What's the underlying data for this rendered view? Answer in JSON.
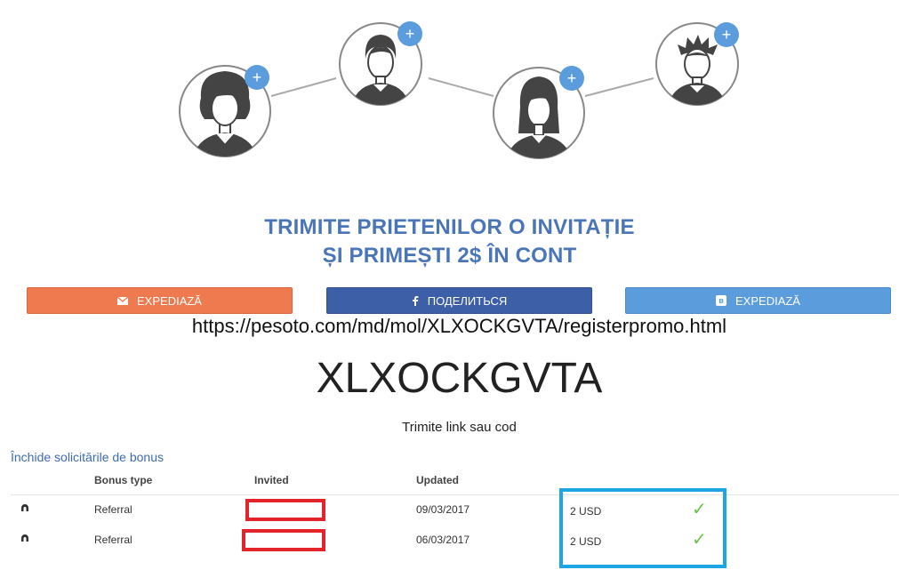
{
  "headline": {
    "line1": "TRIMITE PRIETENILOR O INVITAȚIE",
    "line2": "ȘI PRIMEȘTI 2$ ÎN CONT"
  },
  "share_buttons": [
    {
      "label": "EXPEDIAZĂ",
      "icon": "envelope-icon",
      "color": "#ef7a4f"
    },
    {
      "label": "ПОДЕЛИТЬСЯ",
      "icon": "facebook-icon",
      "color": "#3d5fa8"
    },
    {
      "label": "EXPEDIAZĂ",
      "icon": "vk-icon",
      "color": "#5b9ddc"
    }
  ],
  "referral_link": "https://pesoto.com/md/mol/XLXOCKGVTA/registerpromo.html",
  "promo_code": "XLXOCKGVTA",
  "hint": "Trimite link sau cod",
  "close_requests_link": "Închide solicitările de bonus",
  "table": {
    "headers": {
      "bonus_type": "Bonus type",
      "invited": "Invited",
      "updated": "Updated"
    },
    "rows": [
      {
        "icon": "magnet-icon",
        "bonus_type": "Referral",
        "invited": "",
        "updated": "09/03/2017",
        "amount": "2 USD",
        "status": "✓"
      },
      {
        "icon": "magnet-icon",
        "bonus_type": "Referral",
        "invited": "",
        "updated": "06/03/2017",
        "amount": "2 USD",
        "status": "✓"
      }
    ]
  },
  "colors": {
    "headline": "#4a76b8",
    "plus_badge": "#5b9ddc",
    "check": "#6cc24a",
    "redaction_box": "#e3242b",
    "highlight_box": "#1ea6e4"
  }
}
